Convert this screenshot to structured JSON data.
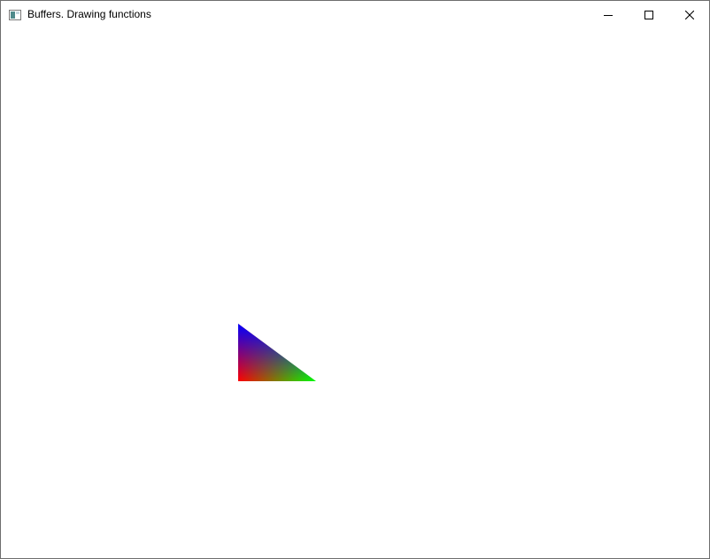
{
  "window": {
    "title": "Buffers. Drawing functions"
  },
  "icons": {
    "app": "app-window-icon",
    "minimize": "minimize-icon",
    "maximize": "maximize-icon",
    "close": "close-icon"
  },
  "scene": {
    "background": "#ffffff",
    "triangle": {
      "vertex_colors": [
        "#0000ff",
        "#ff0000",
        "#00ff00"
      ]
    }
  }
}
